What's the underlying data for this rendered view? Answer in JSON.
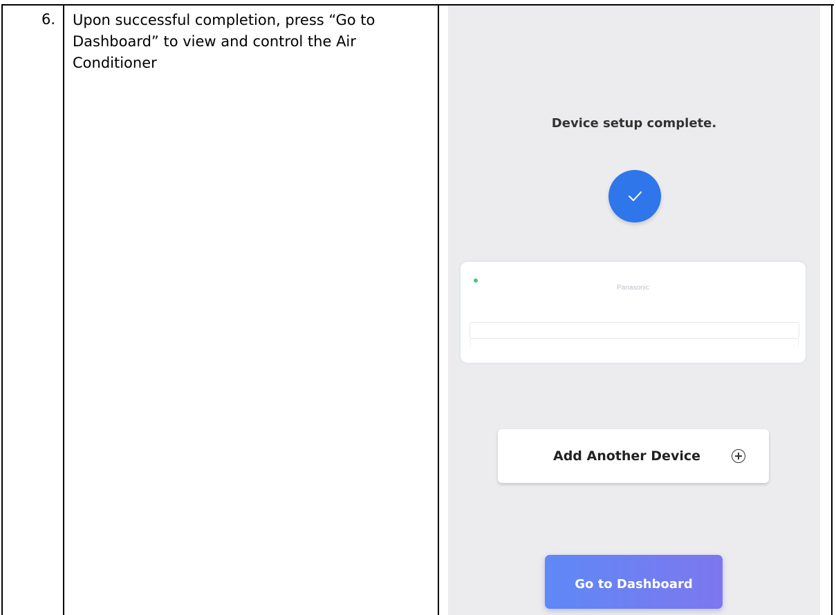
{
  "step": {
    "number": "6.",
    "text": "Upon successful completion, press “Go to Dashboard” to view and control the Air Conditioner"
  },
  "phone": {
    "title": "Device setup complete.",
    "status_icon": "check-icon",
    "device_brand": "Panasonic",
    "add_device_label": "Add Another Device",
    "add_device_icon": "plus-circle-icon",
    "dashboard_button_label": "Go to Dashboard"
  },
  "colors": {
    "check_circle": "#2f76eb",
    "dashboard_gradient_start": "#5f88f6",
    "dashboard_gradient_end": "#7d77ee",
    "status_dot": "#48c774",
    "phone_background": "#ececee"
  }
}
